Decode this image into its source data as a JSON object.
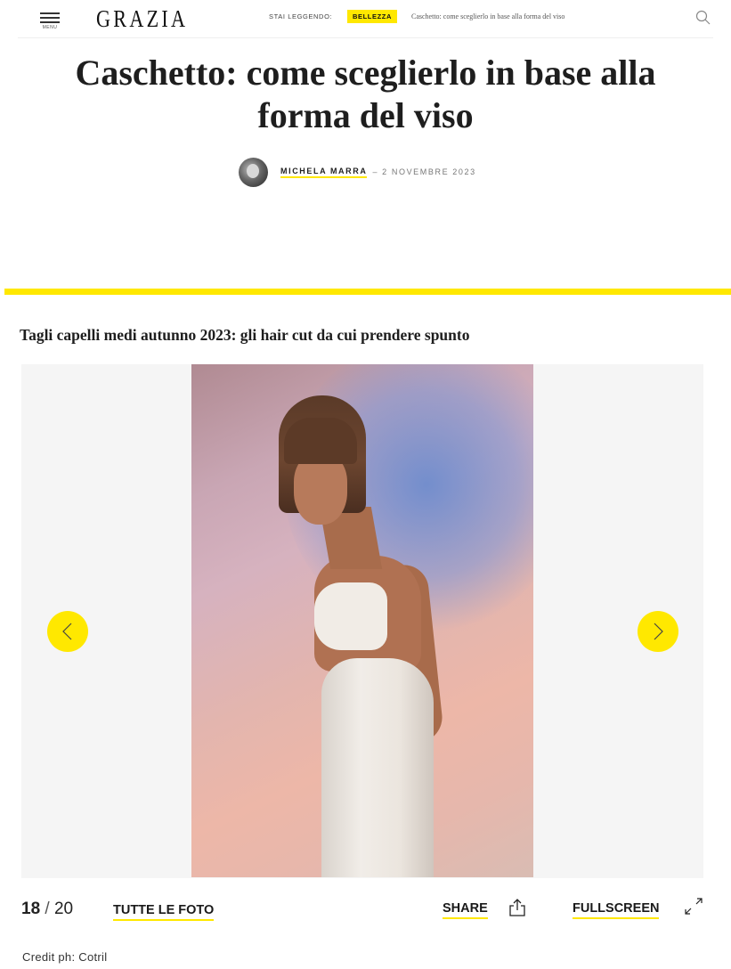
{
  "header": {
    "menu_label": "MENU",
    "logo": "GRAZIA",
    "reading_label": "STAI LEGGENDO:",
    "category_badge": "BELLEZZA",
    "reading_title": "Caschetto: come sceglierlo in base alla forma del viso",
    "accent_color": "#ffe800"
  },
  "article": {
    "title": "Caschetto: come sceglierlo in base alla forma del viso",
    "author": "MICHELA MARRA",
    "date": "– 2 NOVEMBRE 2023"
  },
  "gallery": {
    "title": "Tagli capelli medi autunno 2023: gli hair cut da cui prendere spunto",
    "current": "18",
    "separator": "/",
    "total": "20",
    "all_photos_label": "TUTTE LE FOTO",
    "share_label": "SHARE",
    "fullscreen_label": "FULLSCREEN",
    "credit": "Credit ph: Cotril",
    "icons": {
      "prev": "chevron-left-icon",
      "next": "chevron-right-icon",
      "share": "share-icon",
      "fullscreen": "expand-icon",
      "search": "search-icon",
      "menu": "hamburger-icon"
    }
  }
}
